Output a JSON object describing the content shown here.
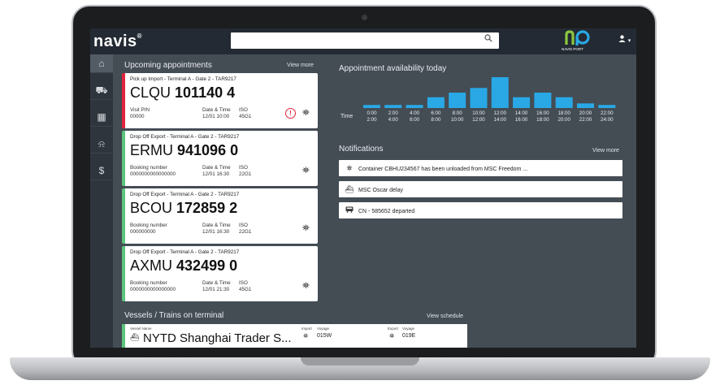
{
  "topbar": {
    "logo": "navis",
    "search_icon": "search-icon",
    "brand_badge": "NAVIS PORT",
    "user_icon": "user-icon",
    "user_caret": "▾"
  },
  "sidebar": {
    "items": [
      {
        "icon": "home-icon",
        "glyph": "⌂",
        "active": true
      },
      {
        "icon": "truck-icon",
        "glyph": "⛟",
        "active": false
      },
      {
        "icon": "calendar-icon",
        "glyph": "▦",
        "active": false
      },
      {
        "icon": "bell-icon",
        "glyph": "⍾",
        "active": false
      },
      {
        "icon": "dollar-icon",
        "glyph": "$",
        "active": false
      }
    ]
  },
  "appointments": {
    "title": "Upcoming appointments",
    "view_more": "View more",
    "cards": [
      {
        "type_line": "Pick up Import - Terminal A - Gate 2 - TAR9217",
        "prefix": "CLQU",
        "number": "101140 4",
        "field1_label": "Visit PIN",
        "field1_value": "00000",
        "dt_label": "Date & Time",
        "dt_value": "12/01 10:00",
        "iso_label": "ISO",
        "iso_value": "45G1",
        "alert": true,
        "status_color": "#e0243a"
      },
      {
        "type_line": "Drop Off Export - Terminal A - Gate 2 - TAR9217",
        "prefix": "ERMU",
        "number": "941096 0",
        "field1_label": "Booking number",
        "field1_value": "0000000000000000",
        "dt_label": "Date & Time",
        "dt_value": "12/01 16:30",
        "iso_label": "ISO",
        "iso_value": "22G1",
        "alert": false,
        "status_color": "#5cc47c"
      },
      {
        "type_line": "Drop Off Export - Terminal A - Gate 2 - TAR9217",
        "prefix": "BCOU",
        "number": "172859 2",
        "field1_label": "Booking number",
        "field1_value": "000000000",
        "dt_label": "Date & Time",
        "dt_value": "12/01 16:30",
        "iso_label": "ISO",
        "iso_value": "22G1",
        "alert": false,
        "status_color": "#5cc47c"
      },
      {
        "type_line": "Drop Off Export - Terminal A - Gate 2 - TAR9217",
        "prefix": "AXMU",
        "number": "432499 0",
        "field1_label": "Booking number",
        "field1_value": "0000000000000000",
        "dt_label": "Date & Time",
        "dt_value": "12/01 21:30",
        "iso_label": "ISO",
        "iso_value": "45G1",
        "alert": false,
        "status_color": "#5cc47c"
      }
    ]
  },
  "availability": {
    "title": "Appointment availability today"
  },
  "chart_data": {
    "type": "bar",
    "title": "Appointment availability today",
    "xlabel": "Time",
    "categories": [
      {
        "from": "0:00",
        "to": "2:00"
      },
      {
        "from": "2:00",
        "to": "4:00"
      },
      {
        "from": "4:00",
        "to": "6:00"
      },
      {
        "from": "6:00",
        "to": "8:00"
      },
      {
        "from": "8:00",
        "to": "10:00"
      },
      {
        "from": "10:00",
        "to": "12:00"
      },
      {
        "from": "12:00",
        "to": "14:00"
      },
      {
        "from": "14:00",
        "to": "16:00"
      },
      {
        "from": "16:00",
        "to": "18:00"
      },
      {
        "from": "18:00",
        "to": "20:00"
      },
      {
        "from": "20:00",
        "to": "22:00"
      },
      {
        "from": "22:00",
        "to": "24:00"
      }
    ],
    "values": [
      0.1,
      0.1,
      0.1,
      0.35,
      0.5,
      0.65,
      1.0,
      0.35,
      0.5,
      0.35,
      0.15,
      0.1
    ],
    "bar_color": "#29a8e5",
    "ylim": [
      0,
      1
    ],
    "grid": false,
    "legend": "none"
  },
  "notifications": {
    "title": "Notifications",
    "view_more": "View more",
    "items": [
      {
        "icon": "crane-icon",
        "glyph": "⛯",
        "text": "Container CBHU234567 has been unloaded from MSC Freedom ..."
      },
      {
        "icon": "ship-icon",
        "glyph": "⛴",
        "text": "MSC Oscar delay"
      },
      {
        "icon": "train-icon",
        "glyph": "🚆",
        "text": "CN - 585652 departed"
      }
    ]
  },
  "vessels": {
    "title": "Vessels / Trains on terminal",
    "view_schedule": "View schedule",
    "row": {
      "name_label": "Vessel Name",
      "name": "NYTD Shanghai Trader S...",
      "import_label": "Import",
      "import_voyage_label": "Voyage",
      "import_voyage": "015W",
      "export_label": "Export",
      "export_voyage_label": "Voyage",
      "export_voyage": "019E"
    }
  }
}
